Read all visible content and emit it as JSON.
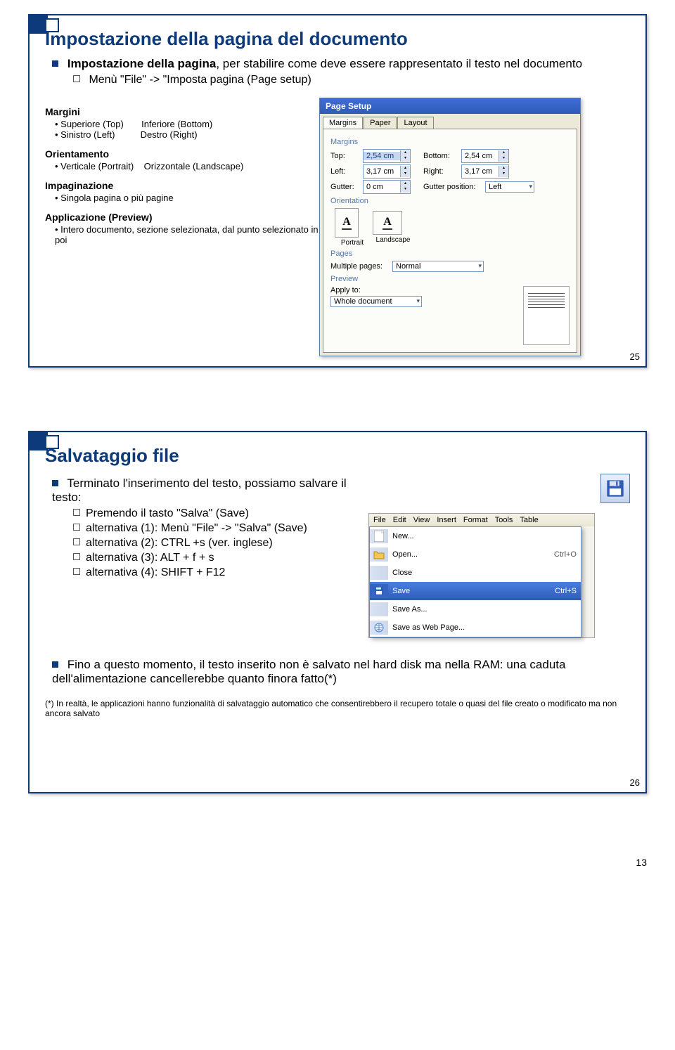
{
  "slide1": {
    "title": "Impostazione della pagina del documento",
    "intro_bold": "Impostazione della pagina",
    "intro_rest": ", per stabilire come deve essere rappresentato il testo nel documento",
    "sub1": "Menù \"File\" -> \"Imposta pagina (Page setup)",
    "margins_label": "Margini",
    "margin_top": "Superiore (Top)",
    "margin_bottom": "Inferiore (Bottom)",
    "margin_left": "Sinistro (Left)",
    "margin_right": "Destro (Right)",
    "orient_label": "Orientamento",
    "orient_vert": "Verticale (Portrait)",
    "orient_horz": "Orizzontale (Landscape)",
    "impag_label": "Impaginazione",
    "impag_text": "Singola pagina o più pagine",
    "app_label": "Applicazione (Preview)",
    "app_text": "Intero documento, sezione selezionata, dal punto selezionato in poi",
    "dialog": {
      "title": "Page Setup",
      "tabs": [
        "Margins",
        "Paper",
        "Layout"
      ],
      "group_margins": "Margins",
      "top_l": "Top:",
      "top_v": "2,54 cm",
      "bottom_l": "Bottom:",
      "bottom_v": "2,54 cm",
      "left_l": "Left:",
      "left_v": "3,17 cm",
      "right_l": "Right:",
      "right_v": "3,17 cm",
      "gutter_l": "Gutter:",
      "gutter_v": "0 cm",
      "gutpos_l": "Gutter position:",
      "gutpos_v": "Left",
      "group_orientation": "Orientation",
      "portrait": "Portrait",
      "landscape": "Landscape",
      "group_pages": "Pages",
      "multiple_l": "Multiple pages:",
      "multiple_v": "Normal",
      "group_preview": "Preview",
      "apply_l": "Apply to:",
      "apply_v": "Whole document"
    },
    "num": "25"
  },
  "slide2": {
    "title": "Salvataggio file",
    "p1": "Terminato l'inserimento del testo, possiamo salvare il testo:",
    "s1": "Premendo il tasto \"Salva\" (Save)",
    "s2": "alternativa (1): Menù \"File\" -> \"Salva\" (Save)",
    "s3": "alternativa (2): CTRL +s (ver. inglese)",
    "s4": "alternativa (3): ALT + f + s",
    "s5": "alternativa (4): SHIFT + F12",
    "menu": {
      "items": [
        "File",
        "Edit",
        "View",
        "Insert",
        "Format",
        "Tools",
        "Table"
      ],
      "new": "New...",
      "open": "Open...",
      "open_k": "Ctrl+O",
      "close": "Close",
      "save": "Save",
      "save_k": "Ctrl+S",
      "saveas": "Save As...",
      "saveweb": "Save as Web Page..."
    },
    "p2": "Fino a questo momento, il testo inserito non è salvato nel hard disk ma nella RAM: una caduta dell'alimentazione cancellerebbe quanto finora fatto(*)",
    "footnote": "(*) In realtà, le applicazioni hanno funzionalità di salvataggio automatico che consentirebbero il recupero totale o quasi del file creato o modificato ma non ancora salvato",
    "num": "26"
  },
  "page_num": "13"
}
